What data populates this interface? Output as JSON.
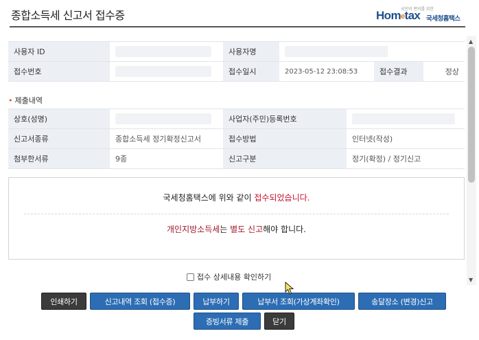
{
  "page": {
    "title": "종합소득세 신고서 접수증"
  },
  "logo": {
    "tagline": "국민의 편의를 위한",
    "brand_pre": "Hom",
    "brand_e": "e",
    "brand_post": "tax",
    "service_name": "국세청홈택스"
  },
  "user_table": {
    "user_id_label": "사용자 ID",
    "user_id_value": "",
    "user_name_label": "사용자명",
    "user_name_value": "",
    "receipt_no_label": "접수번호",
    "receipt_no_value": "",
    "receipt_datetime_label": "접수일시",
    "receipt_datetime_value": "2023-05-12 23:08:53",
    "receipt_result_label": "접수결과",
    "receipt_result_value": "정상"
  },
  "submission": {
    "section_title": "제출내역",
    "company_label": "상호(성명)",
    "company_value": "",
    "biz_no_label": "사업자(주민)등록번호",
    "biz_no_value": "",
    "return_type_label": "신고서종류",
    "return_type_value": "종합소득세 정기확정신고서",
    "method_label": "접수방법",
    "method_value": "인터넷(작성)",
    "attachments_label": "첨부한서류",
    "attachments_value": "9종",
    "category_label": "신고구분",
    "category_value": "정기(확정) / 정기신고"
  },
  "message": {
    "line1_pre": "국세청홈택스에 위와 같이 ",
    "line1_highlight": "접수되었습니다.",
    "line2_highlight1": "개인지방소득세",
    "line2_mid": "는 ",
    "line2_highlight2": "별도 신고",
    "line2_post": "해야 합니다."
  },
  "confirm_checkbox": {
    "label": "접수 상세내용 확인하기",
    "checked": false
  },
  "buttons": {
    "print": "인쇄하기",
    "view_history": "신고내역 조회 (접수증)",
    "pay": "납부하기",
    "bill_lookup": "납부서 조회(가상계좌확인)",
    "delivery_address": "송달장소 (변경)신고",
    "submit_docs": "증빙서류 제출",
    "close": "닫기"
  },
  "colors": {
    "accent_blue": "#2c6db4",
    "dark_button": "#3b3b3b",
    "highlight_red": "#c8102e",
    "table_header_bg": "#eceff4"
  }
}
